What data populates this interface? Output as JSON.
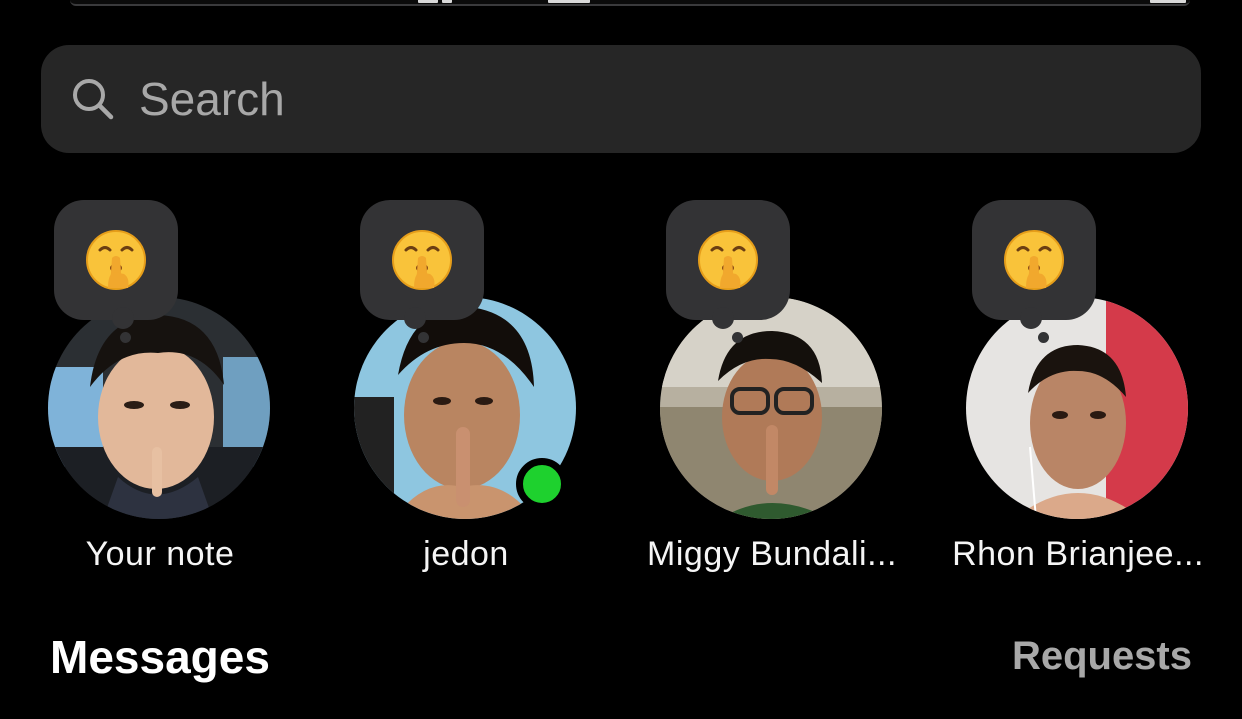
{
  "search": {
    "placeholder": "Search",
    "icon": "search-icon"
  },
  "notes": [
    {
      "name": "Your note",
      "note_emoji": "shushing-face",
      "online": false
    },
    {
      "name": "jedon",
      "note_emoji": "shushing-face",
      "online": true
    },
    {
      "name": "Miggy Bundali...",
      "note_emoji": "shushing-face",
      "online": false
    },
    {
      "name": "Rhon Brianjee...",
      "note_emoji": "shushing-face",
      "online": false
    }
  ],
  "messages": {
    "title": "Messages",
    "requests_label": "Requests"
  },
  "colors": {
    "background": "#000000",
    "search_bg": "#262626",
    "bubble_bg": "#333335",
    "online": "#1ed12e",
    "muted_text": "#a8a8a8"
  }
}
